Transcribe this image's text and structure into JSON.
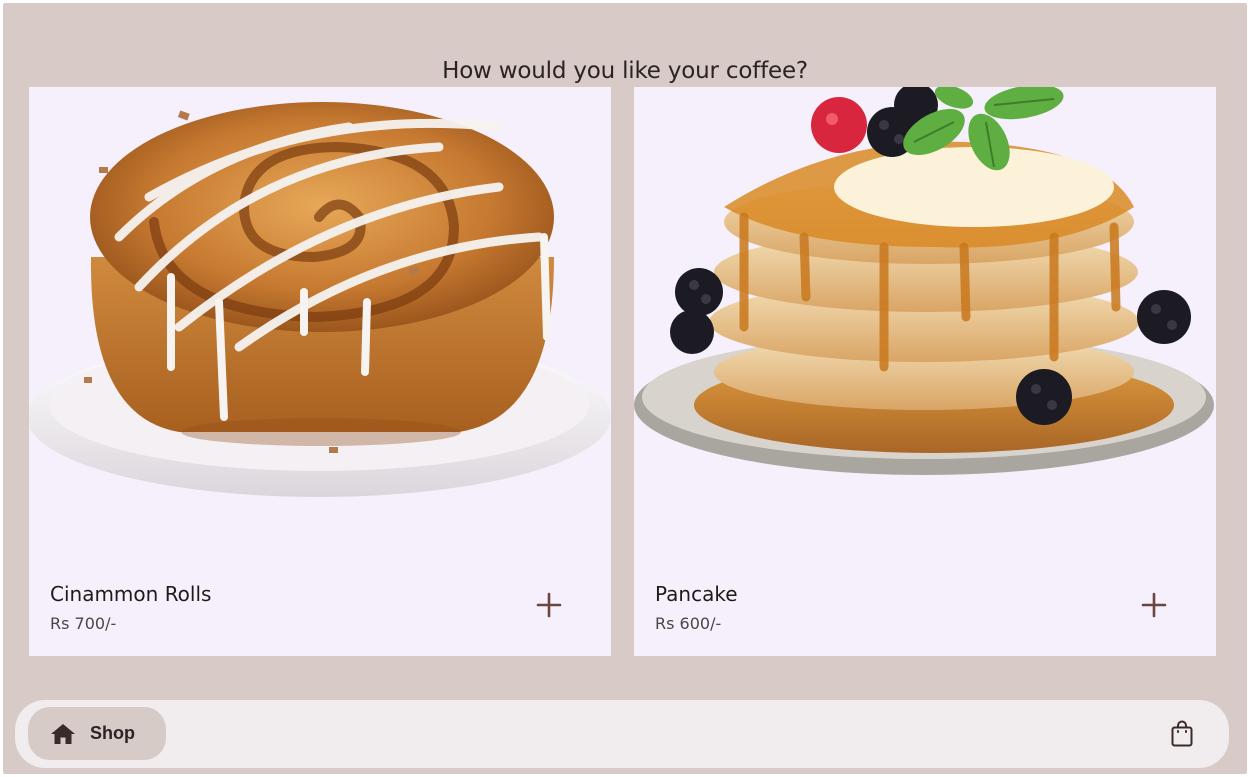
{
  "header": {
    "title": "How would you like your coffee?"
  },
  "products": [
    {
      "name": "Cinammon Rolls",
      "price": "Rs 700/-",
      "image": "cinnamon-roll"
    },
    {
      "name": "Pancake",
      "price": "Rs 600/-",
      "image": "pancake-stack"
    }
  ],
  "nav": {
    "shop_label": "Shop",
    "home_icon": "home-icon",
    "bag_icon": "shopping-bag-icon"
  },
  "colors": {
    "background": "#d7cac7",
    "card": "#f5f0fb",
    "accent": "#6b4641",
    "nav_bar": "#f1edee",
    "nav_active": "#d6cbc7"
  }
}
